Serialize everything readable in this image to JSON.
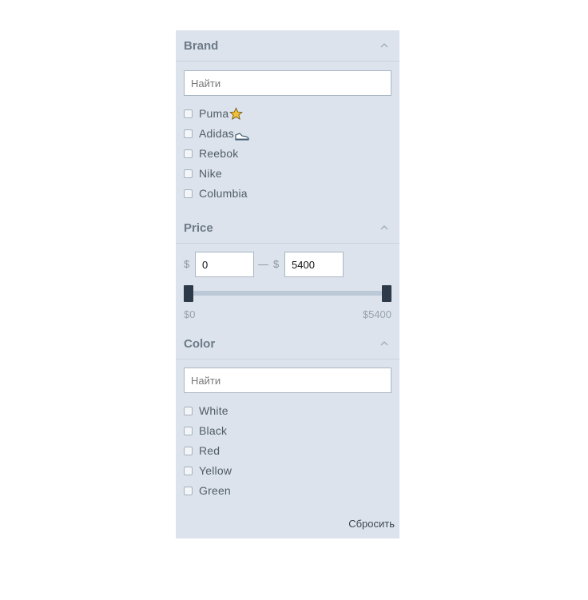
{
  "brand": {
    "title": "Brand",
    "search_placeholder": "Найти",
    "items": [
      {
        "label": "Puma",
        "icon": "star-icon"
      },
      {
        "label": "Adidas",
        "icon": "sneaker-icon"
      },
      {
        "label": "Reebok"
      },
      {
        "label": "Nike"
      },
      {
        "label": "Columbia"
      }
    ]
  },
  "price": {
    "title": "Price",
    "currency": "$",
    "separator": "—",
    "min_value": "0",
    "max_value": "5400",
    "range_min_label": "$0",
    "range_max_label": "$5400",
    "slider_low_fraction": 0,
    "slider_high_fraction": 1
  },
  "color": {
    "title": "Color",
    "search_placeholder": "Найти",
    "items": [
      {
        "label": "White"
      },
      {
        "label": "Black"
      },
      {
        "label": "Red"
      },
      {
        "label": "Yellow"
      },
      {
        "label": "Green"
      }
    ]
  },
  "reset_label": "Сбросить",
  "colors": {
    "panel_bg": "#dce3ec",
    "slider_handle": "#2c3a49",
    "star": "#f2c037"
  }
}
